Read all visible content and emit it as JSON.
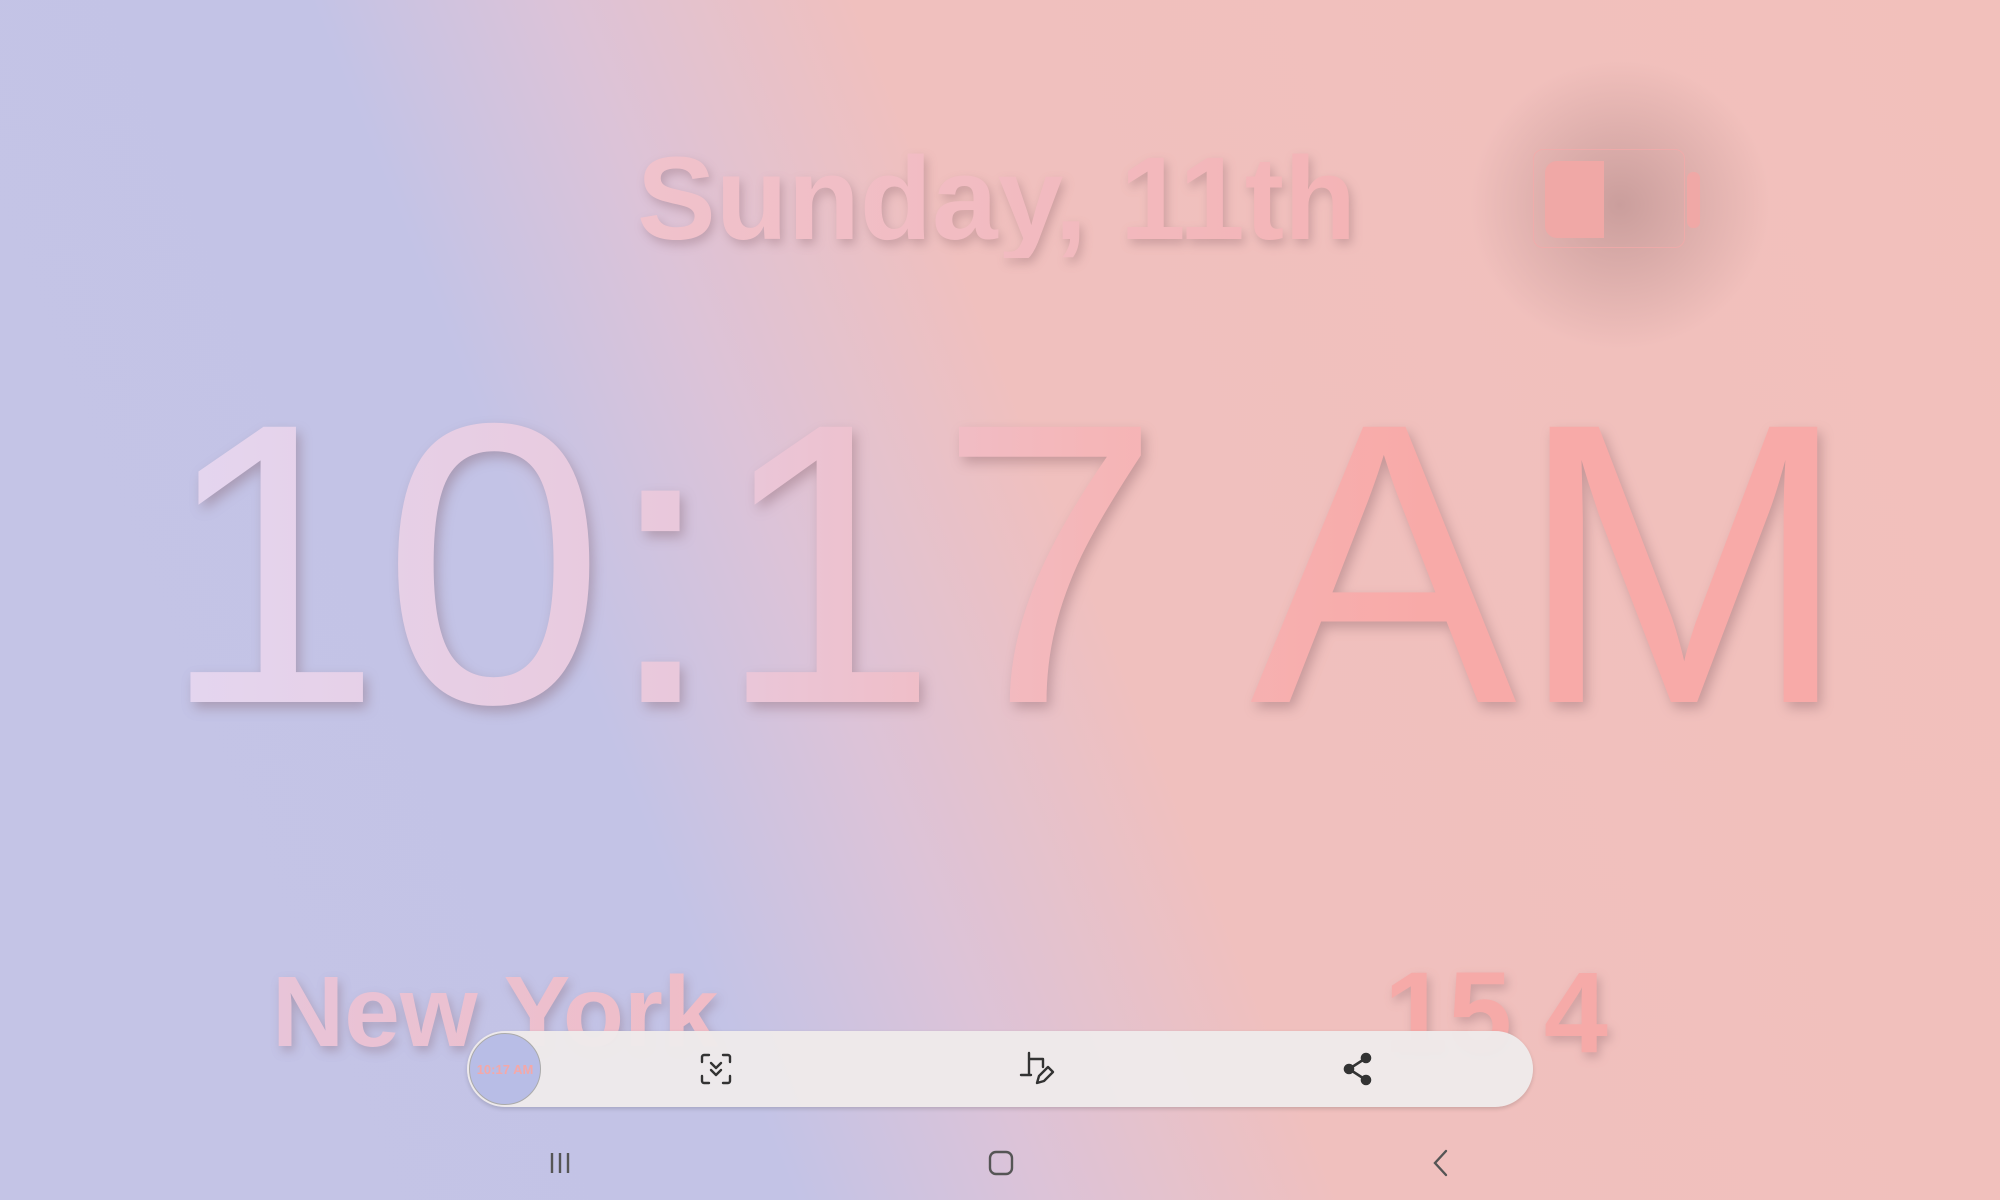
{
  "lockscreen": {
    "date": "Sunday, 11th",
    "time": "10:17 AM",
    "city": "New York",
    "temperature": "15 4",
    "battery_level": 0.45
  },
  "screenshot_toolbar": {
    "thumbnail_text": "10:17 AM",
    "icons": [
      "scroll-capture-icon",
      "crop-edit-icon",
      "share-icon"
    ]
  },
  "nav_bar": {
    "icons": [
      "recents-icon",
      "home-icon",
      "back-icon"
    ]
  }
}
